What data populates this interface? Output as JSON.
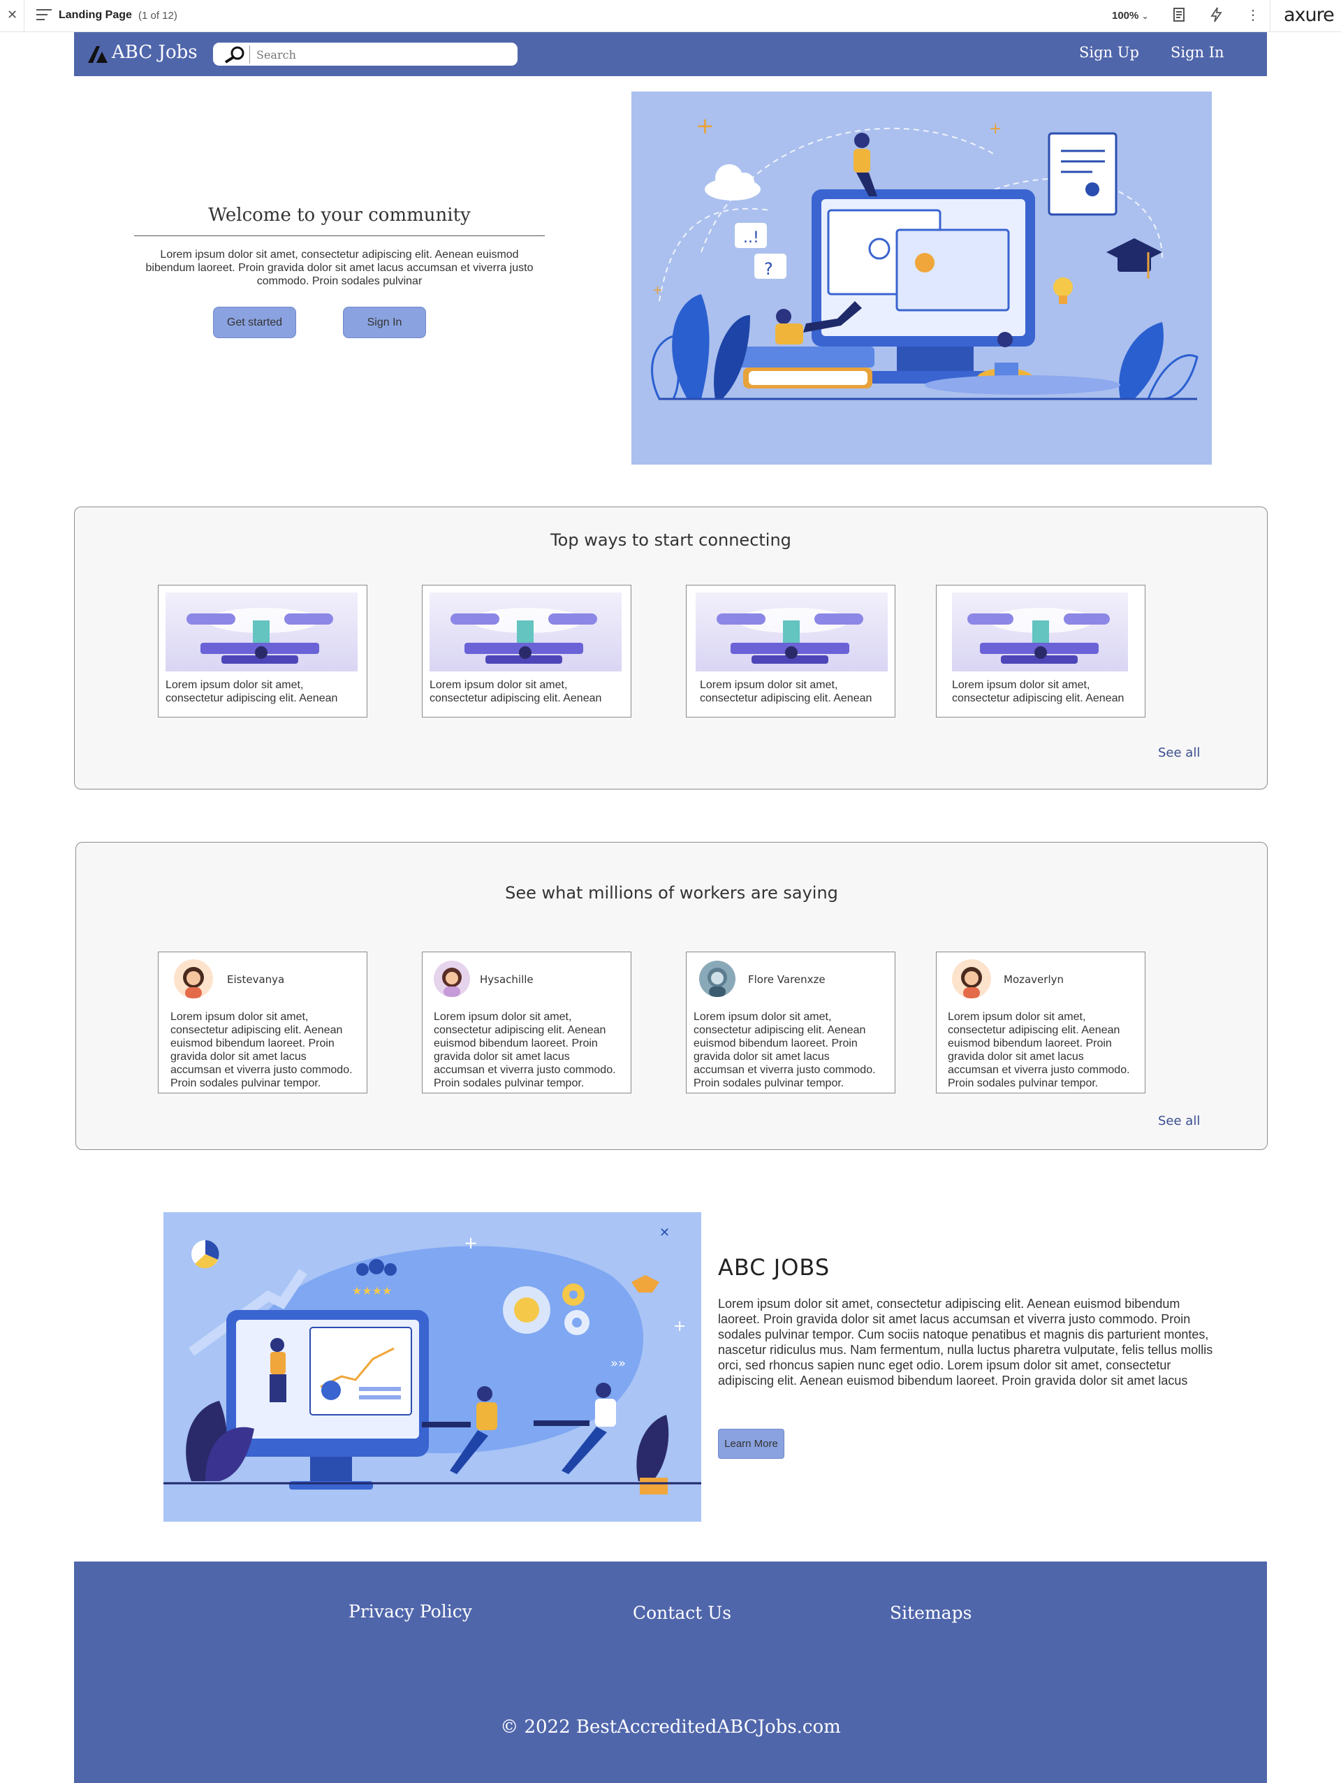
{
  "viewer": {
    "page_title": "Landing Page",
    "page_count": "(1 of 12)",
    "zoom": "100%",
    "brand": "axure"
  },
  "header": {
    "brand": "ABC Jobs",
    "search_placeholder": "Search",
    "signup": "Sign Up",
    "signin": "Sign In"
  },
  "hero": {
    "title": "Welcome to your community",
    "text": "Lorem ipsum dolor sit amet, consectetur adipiscing elit. Aenean euismod bibendum laoreet. Proin gravida dolor sit amet lacus accumsan et viverra justo commodo. Proin sodales pulvinar",
    "get_started": "Get started",
    "sign_in": "Sign In"
  },
  "connect": {
    "title": "Top ways to start connecting",
    "cards": [
      {
        "text": "Lorem ipsum dolor sit amet, consectetur adipiscing elit. Aenean"
      },
      {
        "text": "Lorem ipsum dolor sit amet, consectetur adipiscing elit. Aenean"
      },
      {
        "text": "Lorem ipsum dolor sit amet, consectetur adipiscing elit. Aenean"
      },
      {
        "text": "Lorem ipsum dolor sit amet, consectetur adipiscing elit. Aenean"
      }
    ],
    "see_all": "See all"
  },
  "testimonials": {
    "title": "See what millions of workers are saying",
    "items": [
      {
        "name": "Eistevanya",
        "text": "Lorem ipsum dolor sit amet, consectetur adipiscing elit. Aenean euismod bibendum laoreet. Proin gravida dolor sit amet lacus accumsan et viverra justo commodo. Proin sodales pulvinar tempor."
      },
      {
        "name": "Hysachille",
        "text": "Lorem ipsum dolor sit amet, consectetur adipiscing elit. Aenean euismod bibendum laoreet. Proin gravida dolor sit amet lacus accumsan et viverra justo commodo. Proin sodales pulvinar tempor."
      },
      {
        "name": "Flore Varenxze",
        "text": "Lorem ipsum dolor sit amet, consectetur adipiscing elit. Aenean euismod bibendum laoreet. Proin gravida dolor sit amet lacus accumsan et viverra justo commodo. Proin sodales pulvinar tempor."
      },
      {
        "name": "Mozaverlyn",
        "text": "Lorem ipsum dolor sit amet, consectetur adipiscing elit. Aenean euismod bibendum laoreet. Proin gravida dolor sit amet lacus accumsan et viverra justo commodo. Proin sodales pulvinar tempor."
      }
    ],
    "see_all": "See all"
  },
  "about": {
    "title": "ABC JOBS",
    "text": "Lorem ipsum dolor sit amet, consectetur adipiscing elit. Aenean euismod bibendum laoreet. Proin gravida dolor sit amet lacus accumsan et viverra justo commodo. Proin sodales pulvinar tempor. Cum sociis natoque penatibus et magnis dis parturient montes, nascetur ridiculus mus. Nam fermentum, nulla luctus pharetra vulputate, felis tellus mollis orci, sed rhoncus sapien nunc eget odio. Lorem ipsum dolor sit amet, consectetur adipiscing elit. Aenean euismod bibendum laoreet. Proin gravida dolor sit amet lacus",
    "learn_more": "Learn More"
  },
  "footer": {
    "privacy": "Privacy Policy",
    "contact": "Contact Us",
    "sitemaps": "Sitemaps",
    "copyright": "© 2022 BestAccreditedABCJobs.com"
  },
  "colors": {
    "brand_blue": "#5066ab",
    "button_blue": "#8aa2e0",
    "hero_bg": "#abc0ee",
    "panel_bg": "#f7f7f7"
  }
}
